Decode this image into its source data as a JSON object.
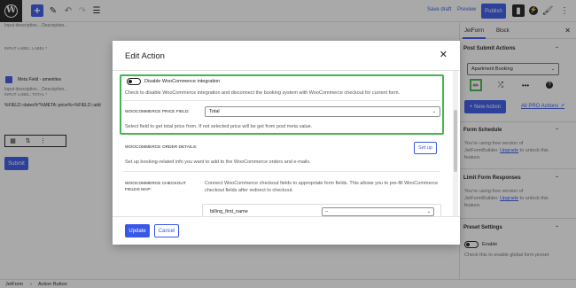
{
  "toolbar": {
    "logo": "wordpress-logo",
    "save_draft": "Save draft",
    "preview": "Preview",
    "publish": "Publish",
    "accent": "#3858e9"
  },
  "editor": {
    "input_description": "Input description... Description...",
    "meta_field_label": "INPUT LABEL:  LABEL *",
    "meta_field_name": "Meta Field - amenities",
    "input_description_2": "Input description... Description...",
    "total_label": "INPUT LABEL:  TOTAL *",
    "formula": "%FIELD::dates%*%META::price%+%FIELD::add",
    "submit": "Submit"
  },
  "sidebar": {
    "tabs": [
      "JetForm",
      "Block"
    ],
    "post_submit_actions": "Post Submit Actions",
    "selected_action": "Apartment Booking",
    "new_action": "+ New Action",
    "pro_actions": "All PRO Actions",
    "form_schedule": "Form Schedule",
    "free_note_1": "You're using free version of JetFormBuilder.",
    "upgrade": "Upgrade",
    "unlock_note": " to unlock this feature.",
    "limit_form_responses": "Limit Form Responses",
    "free_note_2": "You're using free version of JetFormBuilder.",
    "preset_settings": "Preset Settings",
    "enable": "Enable",
    "enable_note": "Check this to enable global form preset"
  },
  "statusbar": {
    "breadcrumb_1": "JetForm",
    "separator": "›",
    "breadcrumb_2": "Action Button"
  },
  "modal": {
    "title": "Edit Action",
    "disable_wc_label": "Disable WooCommerce integration",
    "disable_wc_help": "Check to disable WooCommerce integration and disconnect the booking system with WooCommerce checkout for current form.",
    "price_field_label": "WOOCOMMERCE PRICE FIELD:",
    "price_field_value": "Total",
    "price_field_help": "Select field to get total price from. If not selected price will be get from post meta value.",
    "order_details_label": "WOOCOMMERCE ORDER DETAILS:",
    "setup_button": "Set up",
    "order_details_help": "Set up booking-related info you want to add to the WooCommerce orders and e-mails.",
    "checkout_fields_label": "WOOCOMMERCE CHECKOUT FIELDS MAP:",
    "checkout_fields_help": "Connect WooCommerce checkout fields to appropriate form fields. This allows you to pre-fill WooCommerce checkout fields after redirect to checkout.",
    "billing_first_name": "billing_first_name",
    "billing_select_value": "--",
    "update": "Update",
    "cancel": "Cancel",
    "highlight_color": "#46b450"
  }
}
